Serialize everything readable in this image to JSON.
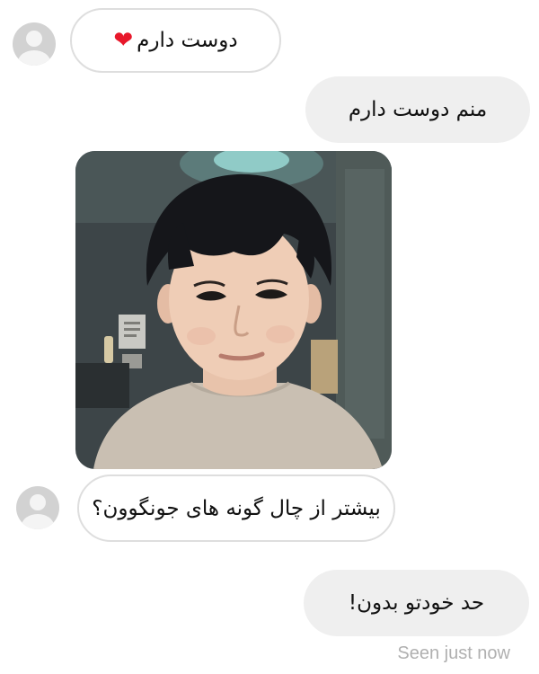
{
  "messages": {
    "m1": {
      "text": "دوست دارم",
      "emoji": "❤"
    },
    "m2": {
      "text": "منم دوست دارم"
    },
    "m3": {
      "text": "بیشتر از چال گونه های جونگوون؟"
    },
    "m4": {
      "text": "حد خودتو بدون!"
    }
  },
  "status": {
    "seen": "Seen just now"
  },
  "colors": {
    "incoming_border": "#dedede",
    "outgoing_bg": "#efefef",
    "heart": "#e8182b",
    "seen_text": "#b0b0b0"
  }
}
